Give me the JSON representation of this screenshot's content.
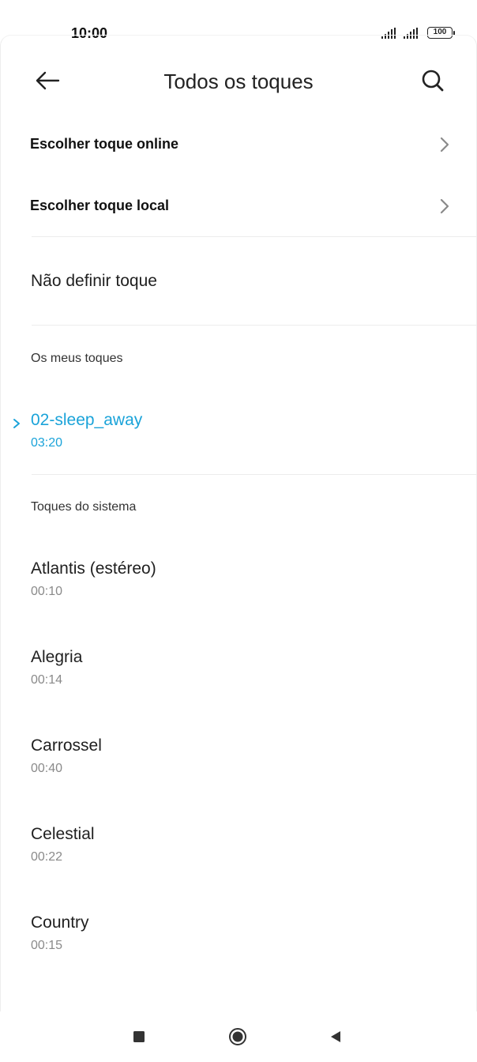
{
  "status_bar": {
    "time": "10:00",
    "battery": "100"
  },
  "header": {
    "title": "Todos os toques"
  },
  "options": {
    "online_label": "Escolher toque online",
    "local_label": "Escolher toque local",
    "none_label": "Não definir toque"
  },
  "my_tones": {
    "header": "Os meus toques",
    "items": [
      {
        "name": "02-sleep_away",
        "duration": "03:20",
        "selected": true
      }
    ]
  },
  "system_tones": {
    "header": "Toques do sistema",
    "items": [
      {
        "name": "Atlantis (estéreo)",
        "duration": "00:10"
      },
      {
        "name": "Alegria",
        "duration": "00:14"
      },
      {
        "name": "Carrossel",
        "duration": "00:40"
      },
      {
        "name": "Celestial",
        "duration": "00:22"
      },
      {
        "name": "Country",
        "duration": "00:15"
      }
    ]
  },
  "colors": {
    "accent": "#1aa3d9",
    "text_primary": "#1f1f1f",
    "text_secondary": "#8a8a8a"
  },
  "icons": {
    "back": "arrow-left-icon",
    "search": "search-icon",
    "chevron": "chevron-right-icon",
    "selected": "selected-chevron-icon",
    "nav_recents": "square-icon",
    "nav_home": "circle-icon",
    "nav_back": "triangle-back-icon"
  }
}
